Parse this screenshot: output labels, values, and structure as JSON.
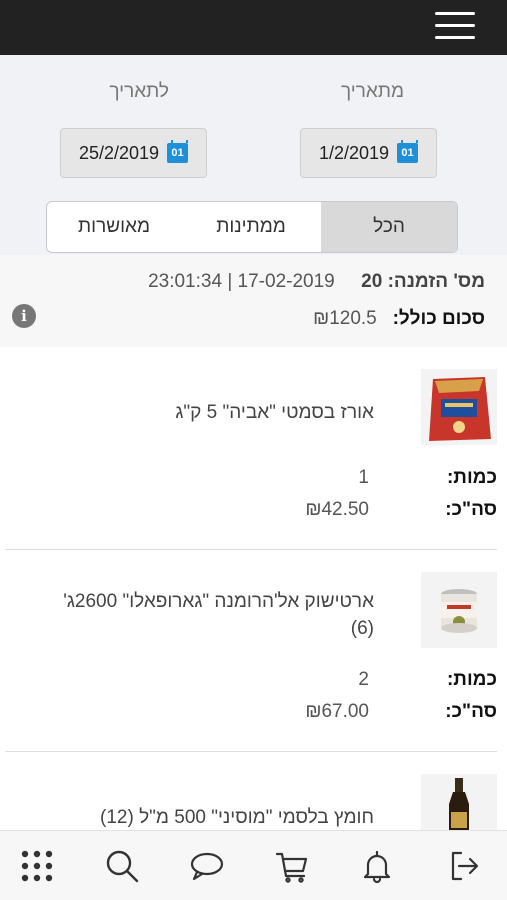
{
  "header": {
    "menu_icon": "hamburger-menu-icon"
  },
  "filters": {
    "from_label": "מתאריך",
    "to_label": "לתאריך",
    "from_date": "1/2/2019",
    "to_date": "25/2/2019",
    "calendar_icon_text": "01",
    "tabs": [
      {
        "label": "הכל",
        "active": true
      },
      {
        "label": "ממתינות",
        "active": false
      },
      {
        "label": "מאושרות",
        "active": false
      }
    ]
  },
  "order": {
    "number_label": "מס' הזמנה:",
    "number": "20",
    "date": "17-02-2019",
    "separator": "|",
    "time": "23:01:34",
    "total_label": "סכום כולל:",
    "total": "₪120.5",
    "info_icon": "i"
  },
  "products": [
    {
      "name": "אורז בסמטי \"אביה\" 5 ק\"ג",
      "qty_label": "כמות:",
      "qty": "1",
      "sum_label": "סה\"כ:",
      "sum": "₪42.50"
    },
    {
      "name": "ארטישוק אל'הרומנה \"גארופאלו\" 2600ג' (6)",
      "qty_label": "כמות:",
      "qty": "2",
      "sum_label": "סה\"כ:",
      "sum": "₪67.00"
    },
    {
      "name": "חומץ בלסמי \"מוסיני\" 500 מ\"ל (12)"
    }
  ],
  "bottom_nav": [
    "logout-icon",
    "bell-icon",
    "cart-icon",
    "chat-icon",
    "search-icon",
    "apps-grid-icon"
  ],
  "colors": {
    "topbar": "#222222",
    "calendar_icon": "#1e90d8",
    "active_tab": "#d9d9d9"
  }
}
